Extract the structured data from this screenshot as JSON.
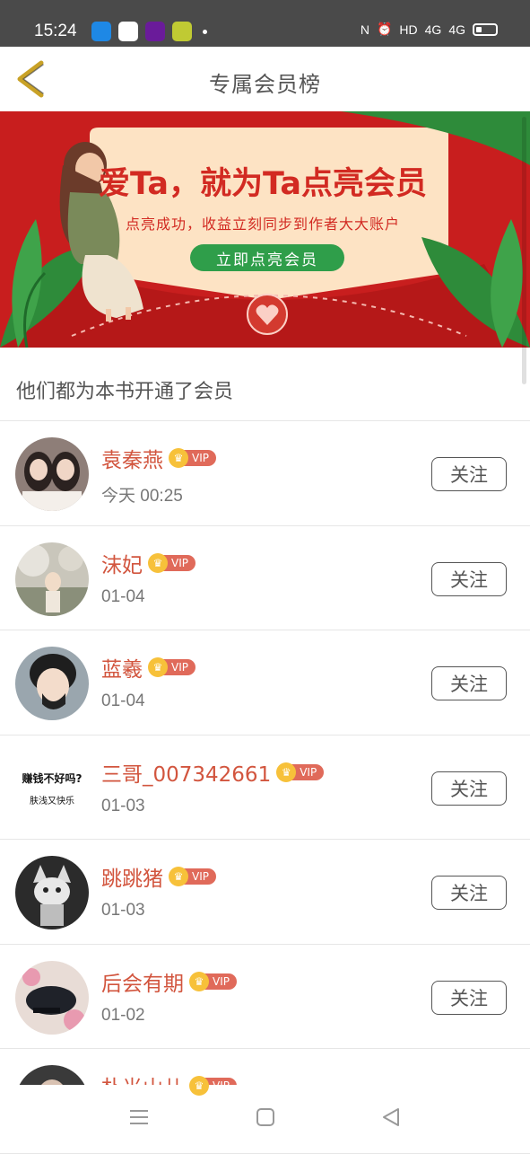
{
  "status_bar": {
    "time": "15:24",
    "network": "HD",
    "signal1": "4G",
    "signal2": "4G"
  },
  "header": {
    "title": "专属会员榜",
    "back_icon": "chevron-left-icon",
    "accent": "#c9a227"
  },
  "banner": {
    "headline": "爱Ta，就为Ta点亮会员",
    "subline": "点亮成功，收益立刻同步到作者大大账户",
    "cta": "立即点亮会员"
  },
  "section_title": "他们都为本书开通了会员",
  "vip_label": "VIP",
  "follow_label": "关注",
  "members": [
    {
      "name": "袁秦燕",
      "date": "今天 00:25",
      "avatar_color": "#7a6a66"
    },
    {
      "name": "沫妃",
      "date": "01-04",
      "avatar_color": "#b9b4a8"
    },
    {
      "name": "蓝羲",
      "date": "01-04",
      "avatar_color": "#5e6d7a"
    },
    {
      "name": "三哥_007342661",
      "date": "01-03",
      "avatar_color": "#ffffff"
    },
    {
      "name": "跳跳猪",
      "date": "01-03",
      "avatar_color": "#2d2d2d"
    },
    {
      "name": "后会有期",
      "date": "01-02",
      "avatar_color": "#d9c8c2"
    },
    {
      "name": "朴光山儿",
      "date": "",
      "avatar_color": "#3a3a3a"
    }
  ],
  "avatar_texts": {
    "m3_line1": "赚钱不好吗?",
    "m3_line2": "肤浅又快乐"
  },
  "colors": {
    "name": "#d2553e",
    "vip_badge": "#e06a5a",
    "crown": "#f7c13a",
    "banner_red": "#c81e1e",
    "banner_card": "#fde3c4"
  }
}
